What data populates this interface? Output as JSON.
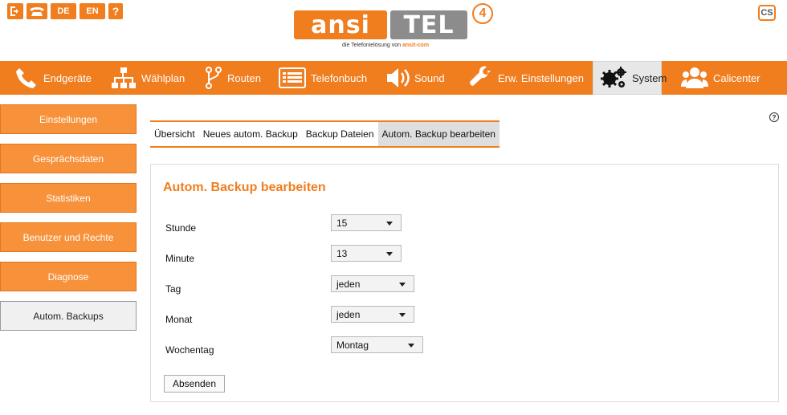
{
  "topbar": {
    "lang_de": "DE",
    "lang_en": "EN",
    "help_label": "?",
    "cs_label": "CS"
  },
  "logo": {
    "left": "ansi",
    "right": "TEL",
    "version": "4",
    "tagline_prefix": "die Telefonielösung von ",
    "tagline_brand": "ansit-com"
  },
  "nav": [
    {
      "label": "Endgeräte",
      "icon": "phone-icon"
    },
    {
      "label": "Wählplan",
      "icon": "sitemap-icon"
    },
    {
      "label": "Routen",
      "icon": "route-icon"
    },
    {
      "label": "Telefonbuch",
      "icon": "phonebook-icon"
    },
    {
      "label": "Sound",
      "icon": "speaker-icon"
    },
    {
      "label": "Erw. Einstellungen",
      "icon": "wrench-icon"
    },
    {
      "label": "System",
      "icon": "gears-icon"
    },
    {
      "label": "Calicenter",
      "icon": "users-icon"
    }
  ],
  "sidebar": [
    {
      "label": "Einstellungen"
    },
    {
      "label": "Gesprächsdaten"
    },
    {
      "label": "Statistiken"
    },
    {
      "label": "Benutzer und Rechte"
    },
    {
      "label": "Diagnose"
    },
    {
      "label": "Autom. Backups"
    }
  ],
  "help": "?",
  "subtabs": [
    {
      "label": "Übersicht"
    },
    {
      "label": "Neues autom. Backup"
    },
    {
      "label": "Backup Dateien"
    },
    {
      "label": "Autom. Backup bearbeiten"
    }
  ],
  "form": {
    "title": "Autom. Backup bearbeiten",
    "stunde_label": "Stunde",
    "stunde_value": "15",
    "minute_label": "Minute",
    "minute_value": "13",
    "tag_label": "Tag",
    "tag_value": "jeden",
    "monat_label": "Monat",
    "monat_value": "jeden",
    "wochentag_label": "Wochentag",
    "wochentag_value": "Montag",
    "submit_label": "Absenden"
  },
  "colors": {
    "accent": "#f07d1e",
    "sidebar": "#f7913a",
    "active_bg": "#e7e7e7"
  }
}
